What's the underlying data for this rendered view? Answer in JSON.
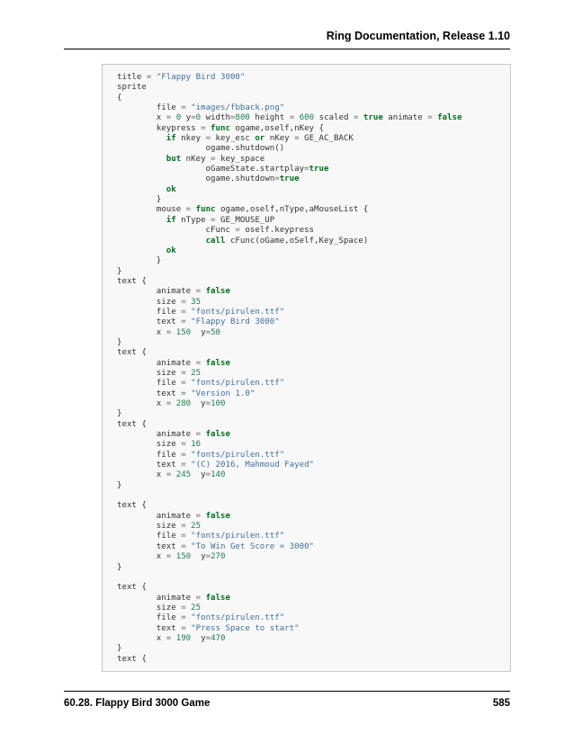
{
  "header": {
    "title": "Ring Documentation, Release 1.10"
  },
  "footer": {
    "section": "60.28.  Flappy Bird 3000 Game",
    "page_number": "585"
  },
  "code": {
    "lines": [
      [
        [
          "",
          "title "
        ],
        [
          "o",
          "="
        ],
        [
          "",
          " "
        ],
        [
          "s",
          "\"Flappy Bird 3000\""
        ]
      ],
      [
        [
          "",
          "sprite"
        ]
      ],
      [
        [
          "",
          "{"
        ]
      ],
      [
        [
          "",
          "        file "
        ],
        [
          "o",
          "="
        ],
        [
          "",
          " "
        ],
        [
          "s",
          "\"images/fbback.png\""
        ]
      ],
      [
        [
          "",
          "        x "
        ],
        [
          "o",
          "="
        ],
        [
          "",
          " "
        ],
        [
          "n",
          "0"
        ],
        [
          "",
          " y"
        ],
        [
          "o",
          "="
        ],
        [
          "n",
          "0"
        ],
        [
          "",
          " width"
        ],
        [
          "o",
          "="
        ],
        [
          "n",
          "800"
        ],
        [
          "",
          " height "
        ],
        [
          "o",
          "="
        ],
        [
          "",
          " "
        ],
        [
          "n",
          "600"
        ],
        [
          "",
          " scaled "
        ],
        [
          "o",
          "="
        ],
        [
          "",
          " "
        ],
        [
          "k",
          "true"
        ],
        [
          "",
          " animate "
        ],
        [
          "o",
          "="
        ],
        [
          "",
          " "
        ],
        [
          "k",
          "false"
        ]
      ],
      [
        [
          "",
          "        keypress "
        ],
        [
          "o",
          "="
        ],
        [
          "",
          " "
        ],
        [
          "k",
          "func"
        ],
        [
          "",
          " ogame,oself,nKey {"
        ]
      ],
      [
        [
          "",
          "          "
        ],
        [
          "k",
          "if"
        ],
        [
          "",
          " nkey "
        ],
        [
          "o",
          "="
        ],
        [
          "",
          " key_esc "
        ],
        [
          "k",
          "or"
        ],
        [
          "",
          " nKey "
        ],
        [
          "o",
          "="
        ],
        [
          "",
          " GE_AC_BACK"
        ]
      ],
      [
        [
          "",
          "                  ogame.shutdown()"
        ]
      ],
      [
        [
          "",
          "          "
        ],
        [
          "k",
          "but"
        ],
        [
          "",
          " nKey "
        ],
        [
          "o",
          "="
        ],
        [
          "",
          " key_space"
        ]
      ],
      [
        [
          "",
          "                  oGameState.startplay"
        ],
        [
          "o",
          "="
        ],
        [
          "k",
          "true"
        ]
      ],
      [
        [
          "",
          "                  ogame.shutdown"
        ],
        [
          "o",
          "="
        ],
        [
          "k",
          "true"
        ]
      ],
      [
        [
          "",
          "          "
        ],
        [
          "k",
          "ok"
        ]
      ],
      [
        [
          "",
          "        }"
        ]
      ],
      [
        [
          "",
          "        mouse "
        ],
        [
          "o",
          "="
        ],
        [
          "",
          " "
        ],
        [
          "k",
          "func"
        ],
        [
          "",
          " ogame,oself,nType,aMouseList {"
        ]
      ],
      [
        [
          "",
          "          "
        ],
        [
          "k",
          "if"
        ],
        [
          "",
          " nType "
        ],
        [
          "o",
          "="
        ],
        [
          "",
          " GE_MOUSE_UP"
        ]
      ],
      [
        [
          "",
          "                  cFunc "
        ],
        [
          "o",
          "="
        ],
        [
          "",
          " oself.keypress"
        ]
      ],
      [
        [
          "",
          "                  "
        ],
        [
          "k",
          "call"
        ],
        [
          "",
          " cFunc(oGame,oSelf,Key_Space)"
        ]
      ],
      [
        [
          "",
          "          "
        ],
        [
          "k",
          "ok"
        ]
      ],
      [
        [
          "",
          "        }"
        ]
      ],
      [
        [
          "",
          "}"
        ]
      ],
      [
        [
          "",
          "text {"
        ]
      ],
      [
        [
          "",
          "        animate "
        ],
        [
          "o",
          "="
        ],
        [
          "",
          " "
        ],
        [
          "k",
          "false"
        ]
      ],
      [
        [
          "",
          "        size "
        ],
        [
          "o",
          "="
        ],
        [
          "",
          " "
        ],
        [
          "n",
          "35"
        ]
      ],
      [
        [
          "",
          "        file "
        ],
        [
          "o",
          "="
        ],
        [
          "",
          " "
        ],
        [
          "s",
          "\"fonts/pirulen.ttf\""
        ]
      ],
      [
        [
          "",
          "        text "
        ],
        [
          "o",
          "="
        ],
        [
          "",
          " "
        ],
        [
          "s",
          "\"Flappy Bird 3000\""
        ]
      ],
      [
        [
          "",
          "        x "
        ],
        [
          "o",
          "="
        ],
        [
          "",
          " "
        ],
        [
          "n",
          "150"
        ],
        [
          "",
          "  y"
        ],
        [
          "o",
          "="
        ],
        [
          "n",
          "50"
        ]
      ],
      [
        [
          "",
          "}"
        ]
      ],
      [
        [
          "",
          "text {"
        ]
      ],
      [
        [
          "",
          "        animate "
        ],
        [
          "o",
          "="
        ],
        [
          "",
          " "
        ],
        [
          "k",
          "false"
        ]
      ],
      [
        [
          "",
          "        size "
        ],
        [
          "o",
          "="
        ],
        [
          "",
          " "
        ],
        [
          "n",
          "25"
        ]
      ],
      [
        [
          "",
          "        file "
        ],
        [
          "o",
          "="
        ],
        [
          "",
          " "
        ],
        [
          "s",
          "\"fonts/pirulen.ttf\""
        ]
      ],
      [
        [
          "",
          "        text "
        ],
        [
          "o",
          "="
        ],
        [
          "",
          " "
        ],
        [
          "s",
          "\"Version 1.0\""
        ]
      ],
      [
        [
          "",
          "        x "
        ],
        [
          "o",
          "="
        ],
        [
          "",
          " "
        ],
        [
          "n",
          "280"
        ],
        [
          "",
          "  y"
        ],
        [
          "o",
          "="
        ],
        [
          "n",
          "100"
        ]
      ],
      [
        [
          "",
          "}"
        ]
      ],
      [
        [
          "",
          "text {"
        ]
      ],
      [
        [
          "",
          "        animate "
        ],
        [
          "o",
          "="
        ],
        [
          "",
          " "
        ],
        [
          "k",
          "false"
        ]
      ],
      [
        [
          "",
          "        size "
        ],
        [
          "o",
          "="
        ],
        [
          "",
          " "
        ],
        [
          "n",
          "16"
        ]
      ],
      [
        [
          "",
          "        file "
        ],
        [
          "o",
          "="
        ],
        [
          "",
          " "
        ],
        [
          "s",
          "\"fonts/pirulen.ttf\""
        ]
      ],
      [
        [
          "",
          "        text "
        ],
        [
          "o",
          "="
        ],
        [
          "",
          " "
        ],
        [
          "s",
          "\"(C) 2016, Mahmoud Fayed\""
        ]
      ],
      [
        [
          "",
          "        x "
        ],
        [
          "o",
          "="
        ],
        [
          "",
          " "
        ],
        [
          "n",
          "245"
        ],
        [
          "",
          "  y"
        ],
        [
          "o",
          "="
        ],
        [
          "n",
          "140"
        ]
      ],
      [
        [
          "",
          "}"
        ]
      ],
      [
        [
          "",
          ""
        ]
      ],
      [
        [
          "",
          "text {"
        ]
      ],
      [
        [
          "",
          "        animate "
        ],
        [
          "o",
          "="
        ],
        [
          "",
          " "
        ],
        [
          "k",
          "false"
        ]
      ],
      [
        [
          "",
          "        size "
        ],
        [
          "o",
          "="
        ],
        [
          "",
          " "
        ],
        [
          "n",
          "25"
        ]
      ],
      [
        [
          "",
          "        file "
        ],
        [
          "o",
          "="
        ],
        [
          "",
          " "
        ],
        [
          "s",
          "\"fonts/pirulen.ttf\""
        ]
      ],
      [
        [
          "",
          "        text "
        ],
        [
          "o",
          "="
        ],
        [
          "",
          " "
        ],
        [
          "s",
          "\"To Win Get Score = 3000\""
        ]
      ],
      [
        [
          "",
          "        x "
        ],
        [
          "o",
          "="
        ],
        [
          "",
          " "
        ],
        [
          "n",
          "150"
        ],
        [
          "",
          "  y"
        ],
        [
          "o",
          "="
        ],
        [
          "n",
          "270"
        ]
      ],
      [
        [
          "",
          "}"
        ]
      ],
      [
        [
          "",
          ""
        ]
      ],
      [
        [
          "",
          "text {"
        ]
      ],
      [
        [
          "",
          "        animate "
        ],
        [
          "o",
          "="
        ],
        [
          "",
          " "
        ],
        [
          "k",
          "false"
        ]
      ],
      [
        [
          "",
          "        size "
        ],
        [
          "o",
          "="
        ],
        [
          "",
          " "
        ],
        [
          "n",
          "25"
        ]
      ],
      [
        [
          "",
          "        file "
        ],
        [
          "o",
          "="
        ],
        [
          "",
          " "
        ],
        [
          "s",
          "\"fonts/pirulen.ttf\""
        ]
      ],
      [
        [
          "",
          "        text "
        ],
        [
          "o",
          "="
        ],
        [
          "",
          " "
        ],
        [
          "s",
          "\"Press Space to start\""
        ]
      ],
      [
        [
          "",
          "        x "
        ],
        [
          "o",
          "="
        ],
        [
          "",
          " "
        ],
        [
          "n",
          "190"
        ],
        [
          "",
          "  y"
        ],
        [
          "o",
          "="
        ],
        [
          "n",
          "470"
        ]
      ],
      [
        [
          "",
          "}"
        ]
      ],
      [
        [
          "",
          "text {"
        ]
      ]
    ]
  }
}
